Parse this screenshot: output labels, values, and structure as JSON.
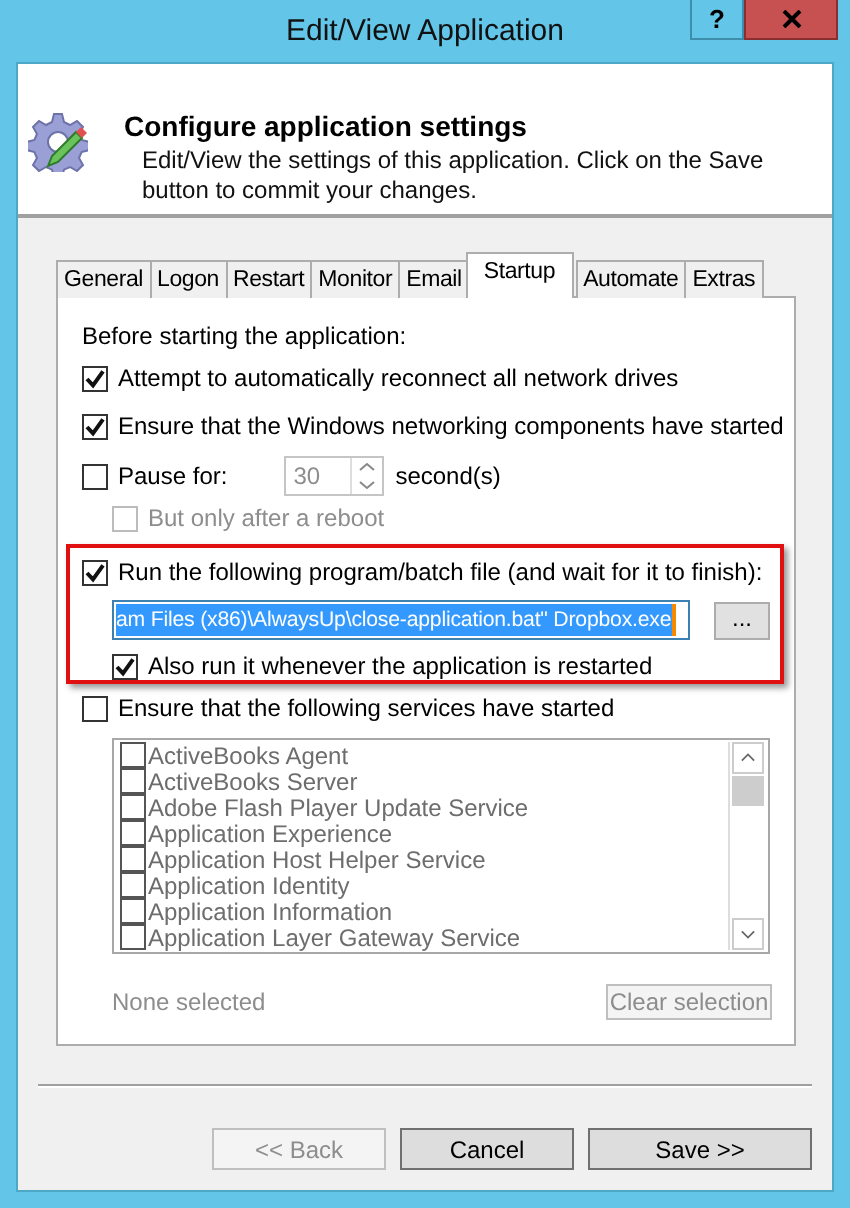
{
  "window": {
    "title": "Edit/View Application",
    "help_button": "?"
  },
  "header": {
    "title": "Configure application settings",
    "description": "Edit/View the settings of this application. Click on the Save button to commit your changes."
  },
  "tabs": [
    {
      "label": "General",
      "selected": false
    },
    {
      "label": "Logon",
      "selected": false
    },
    {
      "label": "Restart",
      "selected": false
    },
    {
      "label": "Monitor",
      "selected": false
    },
    {
      "label": "Email",
      "selected": false
    },
    {
      "label": "Startup",
      "selected": true
    },
    {
      "label": "Automate",
      "selected": false
    },
    {
      "label": "Extras",
      "selected": false
    }
  ],
  "startup": {
    "heading": "Before starting the application:",
    "reconnect": {
      "label": "Attempt to automatically reconnect all network drives",
      "checked": true
    },
    "networking": {
      "label": "Ensure that the Windows networking components have started",
      "checked": true
    },
    "pause": {
      "label": "Pause for:",
      "checked": false,
      "value": "30",
      "unit": "second(s)",
      "disabled": true
    },
    "after_reboot": {
      "label": "But only after a reboot",
      "checked": false,
      "disabled": true
    },
    "run_program": {
      "label": "Run the following program/batch file (and wait for it to finish):",
      "checked": true,
      "highlighted": true,
      "command": "am Files (x86)\\AlwaysUp\\close-application.bat\" Dropbox.exe",
      "browse": "..."
    },
    "run_on_restart": {
      "label": "Also run it whenever the application is restarted",
      "checked": true
    },
    "services": {
      "label": "Ensure that the following services have started",
      "checked": false,
      "disabled": true,
      "items": [
        {
          "label": "ActiveBooks Agent",
          "checked": false
        },
        {
          "label": "ActiveBooks Server",
          "checked": false
        },
        {
          "label": "Adobe Flash Player Update Service",
          "checked": false
        },
        {
          "label": "Application Experience",
          "checked": false
        },
        {
          "label": "Application Host Helper Service",
          "checked": false
        },
        {
          "label": "Application Identity",
          "checked": false
        },
        {
          "label": "Application Information",
          "checked": false
        },
        {
          "label": "Application Layer Gateway Service",
          "checked": false
        }
      ]
    },
    "selection_status": "None selected",
    "clear_button": {
      "label": "Clear selection",
      "disabled": true
    }
  },
  "buttons": [
    {
      "label": "<< Back",
      "disabled": true
    },
    {
      "label": "Cancel",
      "disabled": false
    },
    {
      "label": "Save >>",
      "disabled": false
    }
  ]
}
